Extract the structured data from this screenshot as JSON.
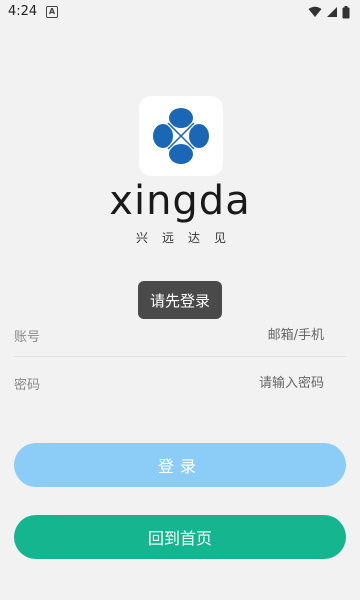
{
  "status_bar": {
    "time": "4:24",
    "notification_icon": "a-box-icon",
    "icons": [
      "wifi-icon",
      "signal-icon",
      "battery-icon"
    ]
  },
  "logo": {
    "brand_name": "xingda",
    "slogan": "兴远达见",
    "icon": "clover-cross-logo",
    "brand_color": "#1a67b5"
  },
  "toast": {
    "message": "请先登录"
  },
  "form": {
    "account": {
      "label": "账号",
      "placeholder": "邮箱/手机",
      "value": ""
    },
    "password": {
      "label": "密码",
      "placeholder": "请输入密码",
      "value": ""
    }
  },
  "buttons": {
    "login_label": "登录",
    "home_label": "回到首页"
  },
  "colors": {
    "background": "#f2f2f2",
    "login_button": "#8ccdf7",
    "home_button": "#15b68f",
    "toast": "#4a4a4a"
  }
}
